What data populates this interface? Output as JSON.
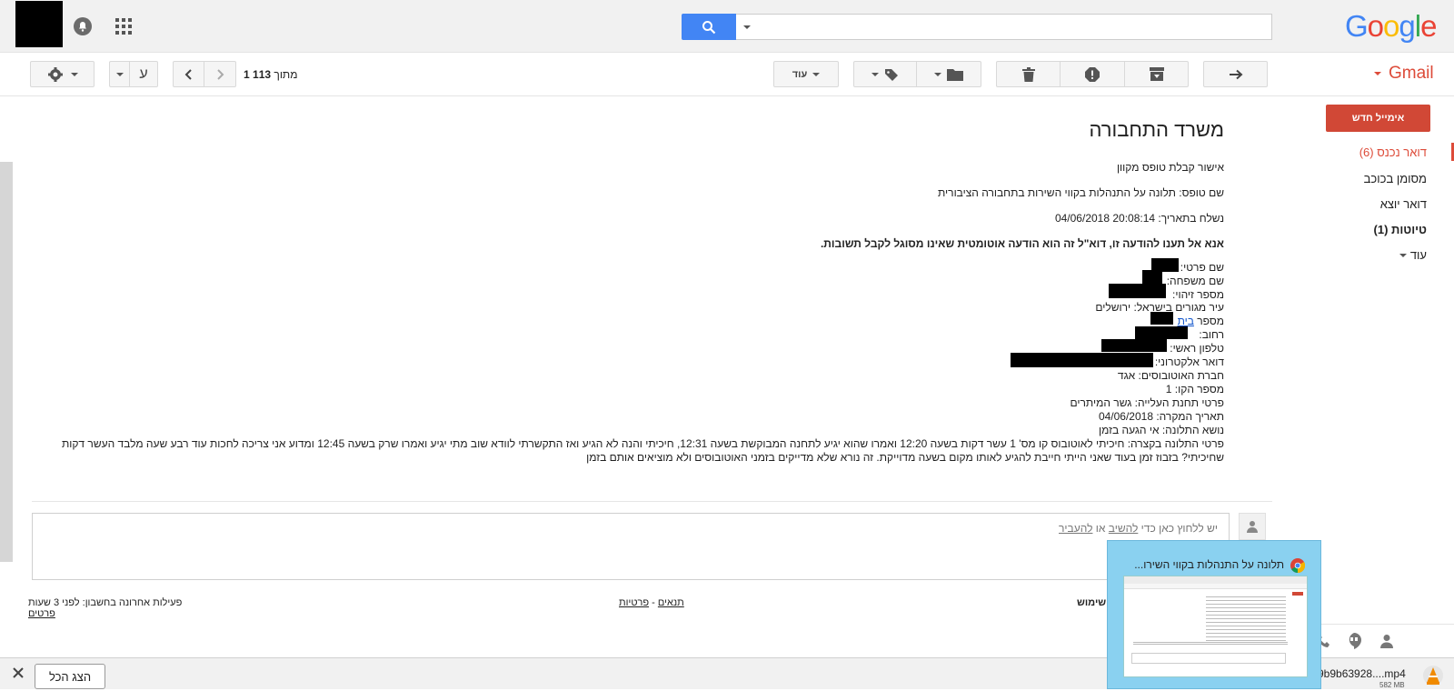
{
  "header": {
    "logo": "Google",
    "search": {
      "placeholder": "",
      "value": ""
    }
  },
  "sidebar": {
    "app_name": "Gmail",
    "compose_label": "אימייל חדש",
    "items": [
      {
        "label": "דואר נכנס (6)"
      },
      {
        "label": "מסומן בכוכב"
      },
      {
        "label": "דואר יוצא"
      },
      {
        "label": "טיוטות (1)"
      },
      {
        "label": "עוד"
      }
    ]
  },
  "toolbar": {
    "more_label": "עוד",
    "pager": {
      "position": "1",
      "of_label": "מתוך",
      "total": "113"
    },
    "language_label": "ע"
  },
  "message": {
    "subject": "משרד התחבורה",
    "lines": [
      "אישור קבלת טופס מקוון",
      "שם טופס: תלונה על התנהלות בקווי השירות בתחבורה הציבורית",
      "נשלח בתאריך: 20:08:14 04/06/2018"
    ],
    "warning": "אנא אל תענו להודעה זו, דוא\"ל זה הוא הודעה אוטומטית שאינו מסוגל לקבל תשובות.",
    "fields": {
      "first_name": "שם פרטי:",
      "last_name": "שם משפחה:",
      "id_number": "מספר זיהוי:",
      "city": "עיר מגורים בישראל: ירושלים",
      "house_number": "מספר",
      "house_link": "בית",
      "street": "רחוב:",
      "phone": "טלפון ראשי:",
      "email": "דואר אלקטרוני:",
      "bus_company": "חברת האוטובוסים: אגד",
      "line_number": "מספר הקו: 1",
      "boarding_station": "פרטי תחנת העלייה: גשר המיתרים",
      "incident_date": "תאריך המקרה: 04/06/2018",
      "complaint_subject": "נושא התלונה: אי הגעה בזמן",
      "details_1": "פרטי התלונה בקצרה: חיכיתי לאוטובוס קו מס' 1 עשר דקות בשעה 12:20 ואמרו שהוא יגיע לתחנה המבוקשת בשעה 12:31, חיכיתי והנה לא הגיע ואז התקשרתי לוודא שוב מתי יגיע ואמרו שרק בשעה 12:45 ומדוע אני צריכה לחכות עוד רבע שעה מלבד העשר דקות",
      "details_2": "שחיכיתי? בזבוז זמן בעוד שאני הייתי חייבת להגיע לאותו מקום בשעה מדוייקת. זה נורא שלא מדייקים בזמני האוטובוסים ולא מוציאים אותם בזמן"
    }
  },
  "reply": {
    "prompt_prefix": "יש ללחוץ כאן כדי",
    "reply_link": "להשיב",
    "or": "או",
    "forward_link": "להעביר"
  },
  "footer": {
    "terms": "תנאים",
    "separator": "-",
    "privacy": "פרטיות",
    "usage_label": "שימוש",
    "last_activity": "פעילות אחרונה בחשבון: לפני 3 שעות",
    "details": "פרטים"
  },
  "popup": {
    "title": "תלונה על התנהלות בקווי השירו..."
  },
  "download_bar": {
    "show_all": "הצג הכל",
    "file_name": "9b9b63928....mp4",
    "file_size": "582 MB"
  },
  "colors": {
    "compose_red": "#d14836",
    "gmail_red": "#dd4b39",
    "search_blue": "#4285f4",
    "popup_blue": "#8ad1f0"
  }
}
